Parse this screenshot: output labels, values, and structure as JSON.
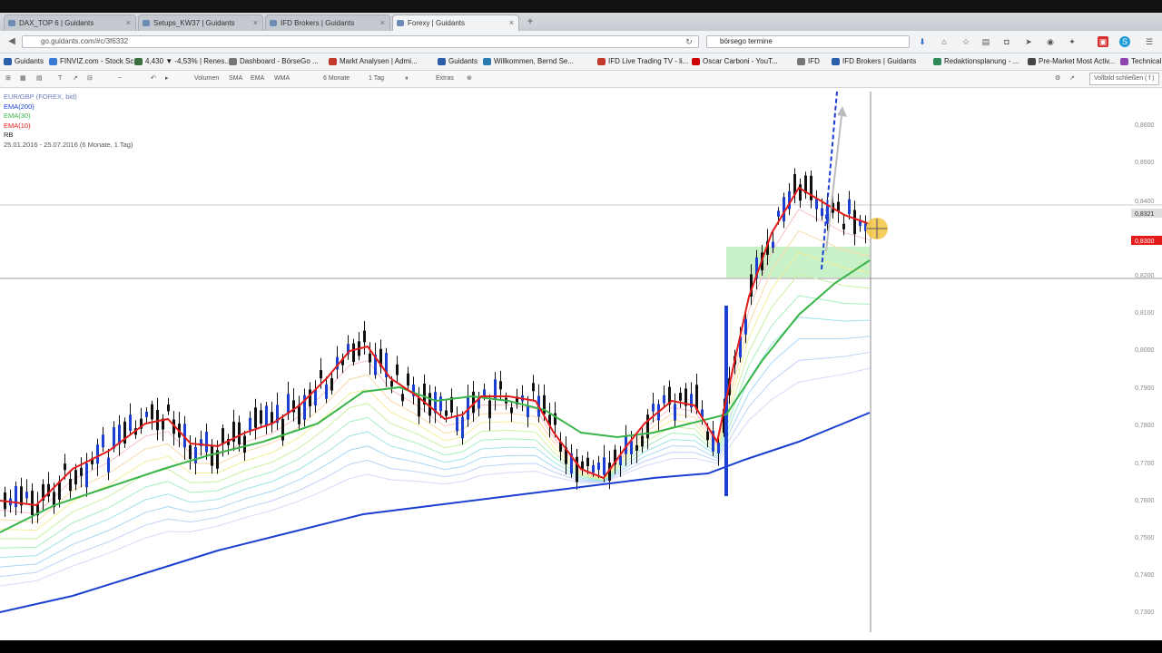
{
  "browser": {
    "tabs": [
      {
        "label": "DAX_TOP 6 | Guidants",
        "active": false
      },
      {
        "label": "Setups_KW37 | Guidants",
        "active": false
      },
      {
        "label": "IFD Brokers | Guidants",
        "active": false
      },
      {
        "label": "Forexy | Guidants",
        "active": true
      }
    ],
    "url": "go.guidants.com/#c/3f6332",
    "search_value": "börsego termine",
    "bookmarks": [
      {
        "label": "Guidants",
        "color": "#2a5ea8"
      },
      {
        "label": "FINVIZ.com - Stock Sc...",
        "color": "#3a7bd5"
      },
      {
        "label": "4,430 ▼ -4,53% | Renes...",
        "color": "#3c6e3c"
      },
      {
        "label": "Dashboard - BörseGo ...",
        "color": "#777777"
      },
      {
        "label": "Markt Analysen | Admi...",
        "color": "#c0392b"
      },
      {
        "label": "Guidants",
        "color": "#2a5ea8"
      },
      {
        "label": "Willkommen, Bernd Se...",
        "color": "#2a7ab0"
      },
      {
        "label": "IFD Live Trading TV - li...",
        "color": "#c0392b"
      },
      {
        "label": "Oscar Carboni - YouT...",
        "color": "#cc0000"
      },
      {
        "label": "IFD",
        "color": "#777777"
      },
      {
        "label": "IFD Brokers | Guidants",
        "color": "#2a5ea8"
      },
      {
        "label": "Redaktionsplanung - ...",
        "color": "#2e8b57"
      },
      {
        "label": "Pre-Market Most Activ...",
        "color": "#444444"
      },
      {
        "label": "Technical Analysis - M...",
        "color": "#8e44ad"
      }
    ]
  },
  "chart_toolbar": {
    "volumen": "Volumen",
    "sma": "SMA",
    "ema": "EMA",
    "wma": "WMA",
    "period": "6 Monate",
    "interval": "1 Tag",
    "extras": "Extras",
    "fullscreen": "Vollbild schließen ( f )"
  },
  "legend": {
    "symbol": "EUR/GBP (FOREX, bid)",
    "ema200": "EMA(200)",
    "ema30": "EMA(30)",
    "ema10": "EMA(10)",
    "rb": "RB",
    "range": "25.01.2016 - 25.07.2016 (6 Monate, 1 Tag)"
  },
  "chart_data": {
    "type": "candlestick",
    "title": "EUR/GBP (FOREX, bid)",
    "series": [
      {
        "name": "EMA(200)",
        "color": "#1a3fd1"
      },
      {
        "name": "EMA(30)",
        "color": "#39b54a"
      },
      {
        "name": "EMA(10)",
        "color": "#e31b1b"
      }
    ],
    "y_tick_labels": [
      "0,8600",
      "0,8500",
      "0,8400",
      "0,8321",
      "0,8200",
      "0,8100",
      "0,8000",
      "0,7900",
      "0,7800",
      "0,7700",
      "0,7600",
      "0,7500",
      "0,7400",
      "0,7300"
    ],
    "current_price_label": "0,8300",
    "crosshair_label": "0,8321",
    "colors": {
      "ema200": "#1a3fd1",
      "ema30": "#39b54a",
      "ema10": "#e31b1b",
      "price_marker": "#e31b1b",
      "support_zone": "#9be59b"
    }
  }
}
